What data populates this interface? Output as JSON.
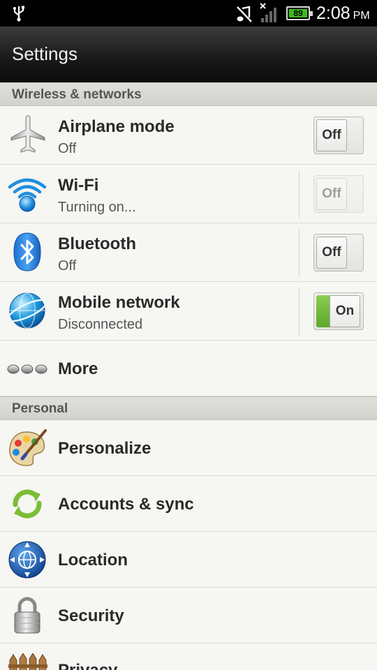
{
  "status_bar": {
    "battery_level": "89",
    "time": "2:08",
    "ampm": "PM"
  },
  "title_bar": {
    "title": "Settings"
  },
  "sections": {
    "wireless": {
      "header": "Wireless & networks"
    },
    "personal": {
      "header": "Personal"
    }
  },
  "items": {
    "airplane": {
      "label": "Airplane mode",
      "summary": "Off",
      "toggle": "Off",
      "enabled": true
    },
    "wifi": {
      "label": "Wi-Fi",
      "summary": "Turning on...",
      "toggle": "Off",
      "enabled": false
    },
    "bluetooth": {
      "label": "Bluetooth",
      "summary": "Off",
      "toggle": "Off",
      "enabled": true
    },
    "mobile": {
      "label": "Mobile network",
      "summary": "Disconnected",
      "toggle": "On",
      "enabled": true
    },
    "more": {
      "label": "More"
    },
    "personalize": {
      "label": "Personalize"
    },
    "accounts": {
      "label": "Accounts & sync"
    },
    "location": {
      "label": "Location"
    },
    "security": {
      "label": "Security"
    },
    "privacy": {
      "label": "Privacy"
    }
  },
  "icons": {
    "airplane": "airplane-icon",
    "wifi": "wifi-icon",
    "bluetooth": "bluetooth-icon",
    "mobile": "globe-icon",
    "more": "more-dots-icon",
    "personalize": "palette-icon",
    "accounts": "sync-icon",
    "location": "location-icon",
    "security": "padlock-icon",
    "privacy": "fence-icon"
  },
  "colors": {
    "accent_green": "#5ea82d",
    "battery_green": "#3dbb1f",
    "wifi_blue": "#1f8fe0"
  }
}
